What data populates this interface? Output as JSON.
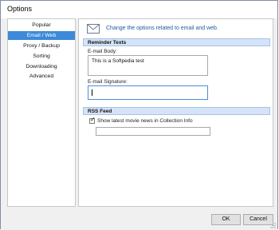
{
  "window": {
    "title": "Options"
  },
  "sidebar": {
    "items": [
      {
        "label": "Popular",
        "active": false
      },
      {
        "label": "Email / Web",
        "active": true
      },
      {
        "label": "Proxy / Backup",
        "active": false
      },
      {
        "label": "Sorting",
        "active": false
      },
      {
        "label": "Downloading",
        "active": false
      },
      {
        "label": "Advanced",
        "active": false
      }
    ]
  },
  "content": {
    "header_text": "Change the options related to email and web.",
    "reminder_section": {
      "title": "Reminder Texts",
      "email_body_label": "E-mail Body:",
      "email_body_value": "This is a Softpedia test",
      "email_signature_label": "E-mail Signature:",
      "email_signature_value": ""
    },
    "rss_section": {
      "title": "RSS Feed",
      "checkbox_label": "Show latest movie news in Collection Info",
      "checkbox_checked": true,
      "feed_value": ""
    }
  },
  "footer": {
    "ok_label": "OK",
    "cancel_label": "Cancel"
  },
  "colors": {
    "accent": "#3c8ad9",
    "header_text": "#1f5a9e",
    "section_header_bg": "#d4e3f7"
  },
  "icons": {
    "header": "mail-icon",
    "checkbox": "checkmark-icon",
    "corner": "resize-grip-icon"
  }
}
